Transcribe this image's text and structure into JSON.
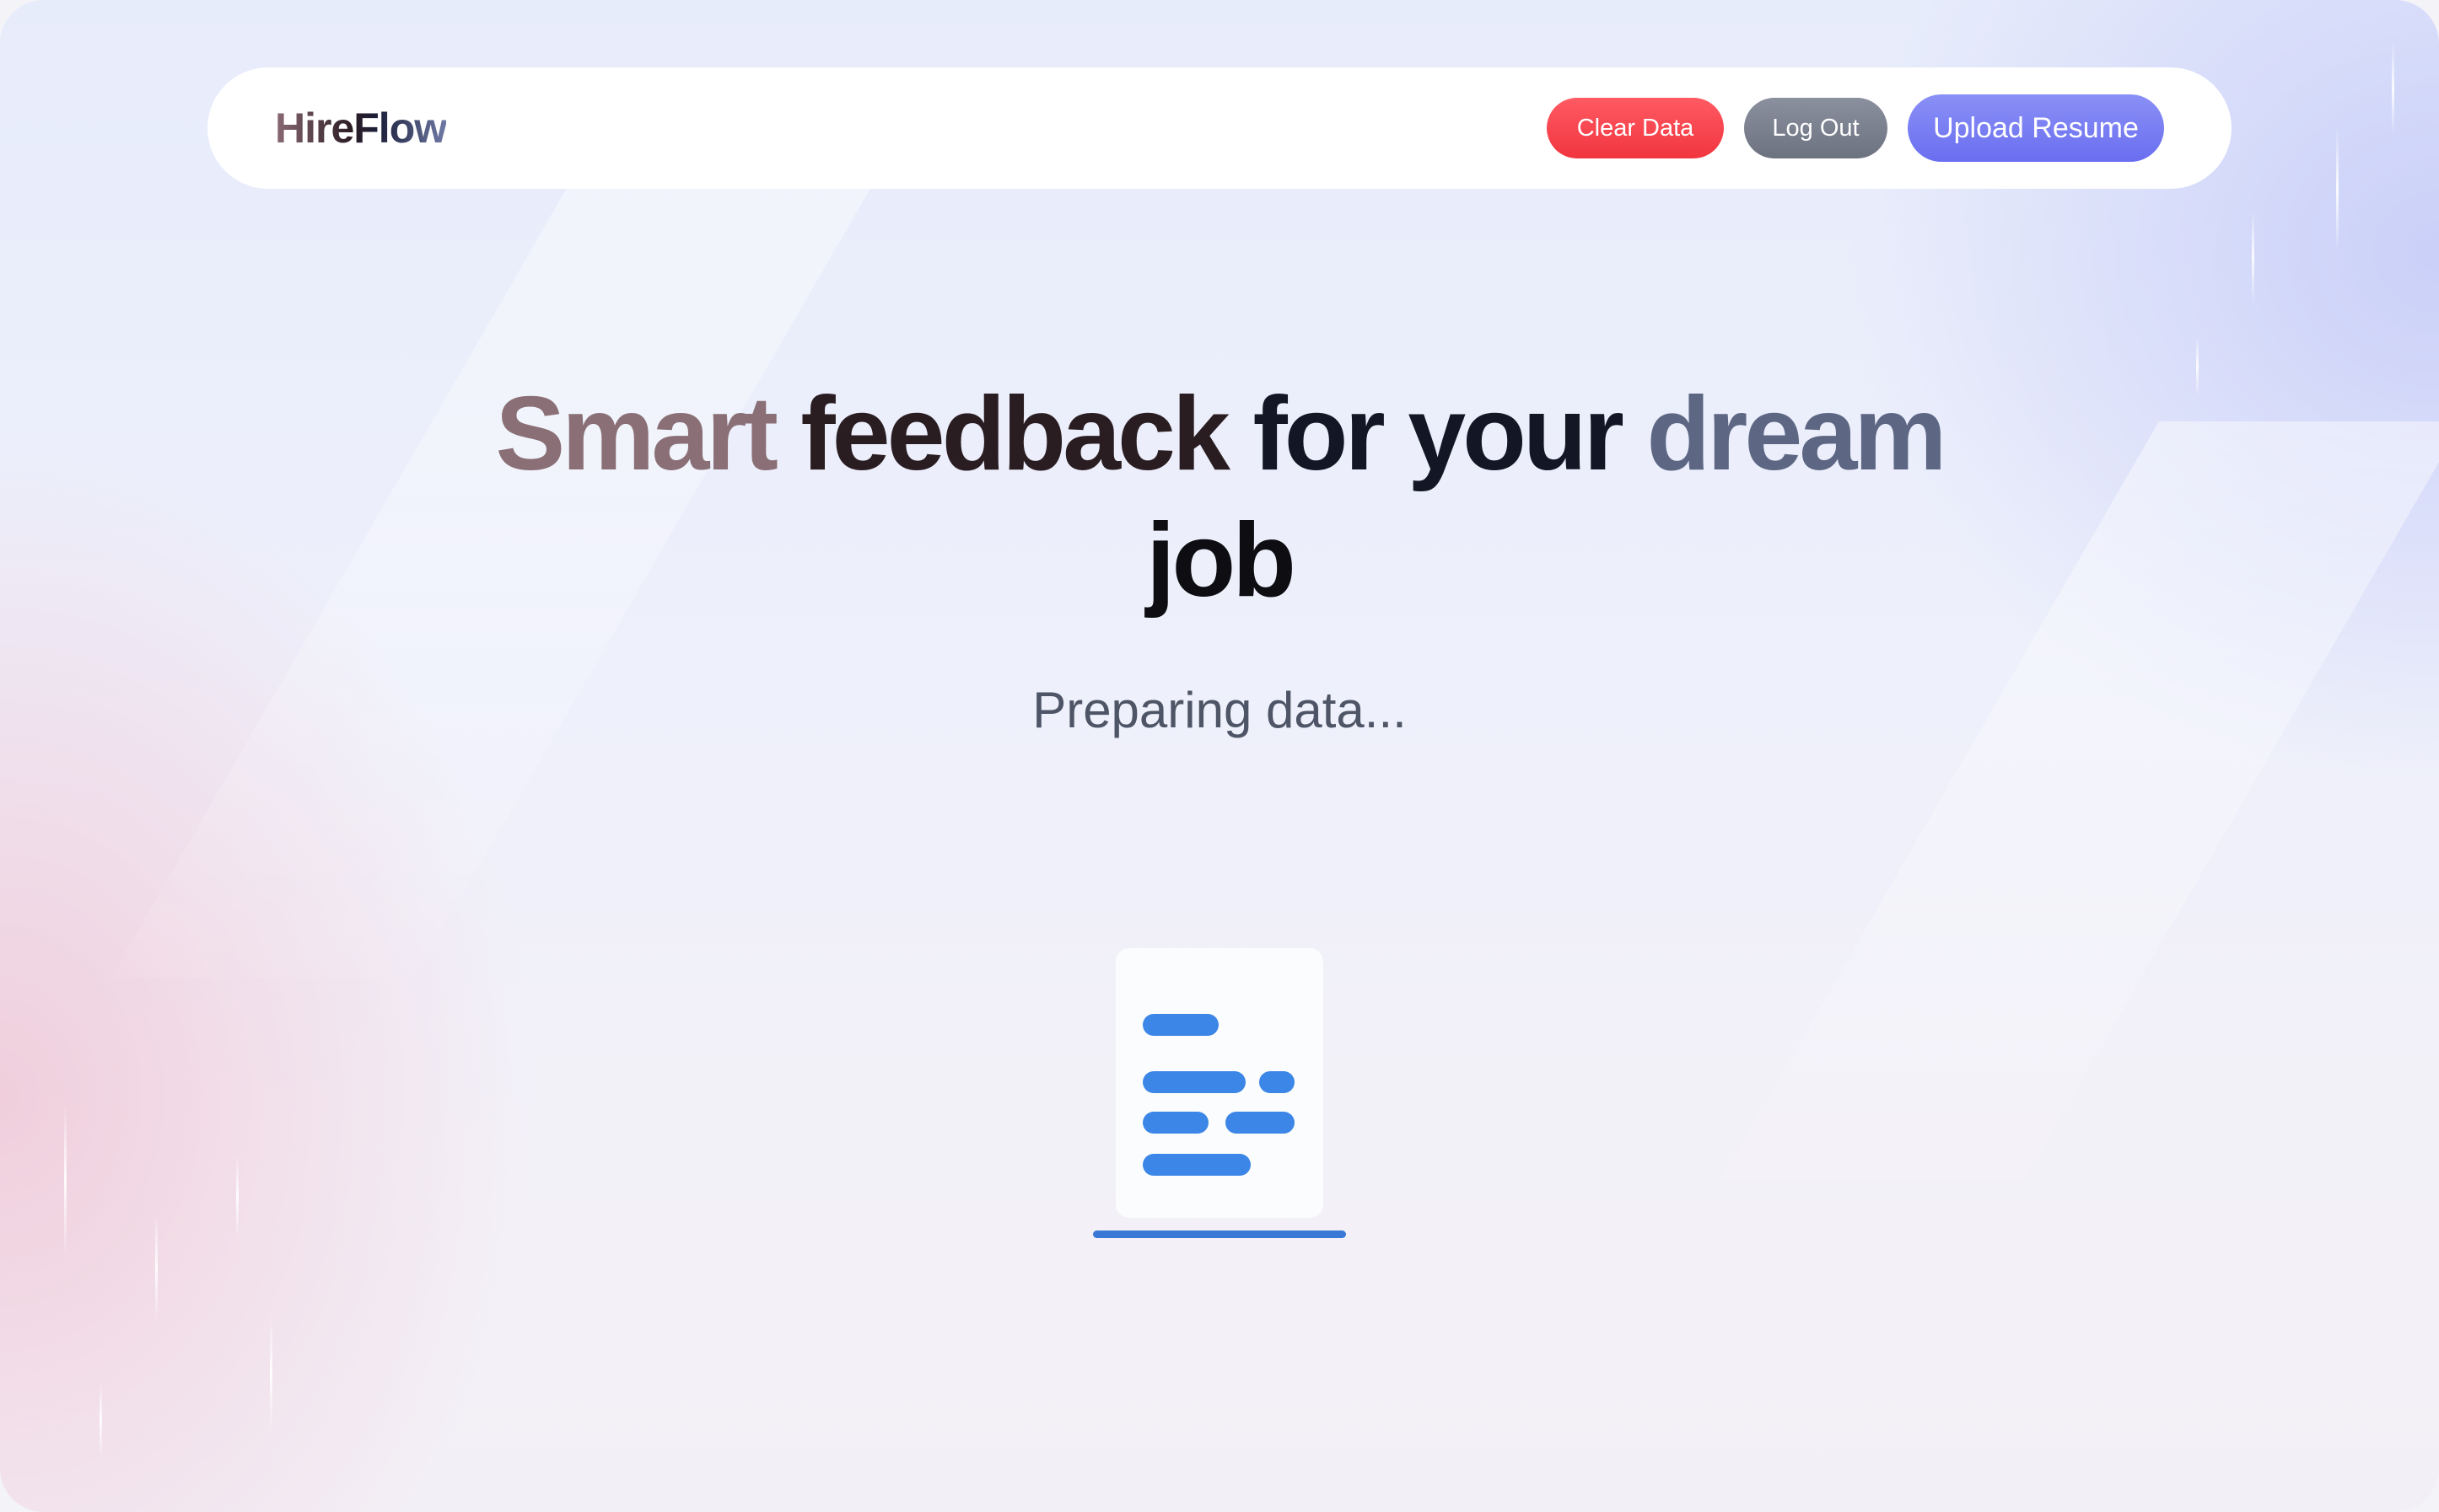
{
  "navbar": {
    "logo": "HireFlow",
    "clear_data_label": "Clear Data",
    "logout_label": "Log Out",
    "upload_label": "Upload Resume"
  },
  "hero": {
    "title_parts": [
      "Smart",
      "feedback",
      "for your",
      "dream",
      "job"
    ],
    "subtitle": "Preparing data..."
  },
  "illustration": {
    "icon": "document-icon",
    "accent_color": "#3b86e6"
  },
  "colors": {
    "clear_button": "#f1353f",
    "logout_button": "#6c7280",
    "upload_button": "#6a6ef0"
  }
}
